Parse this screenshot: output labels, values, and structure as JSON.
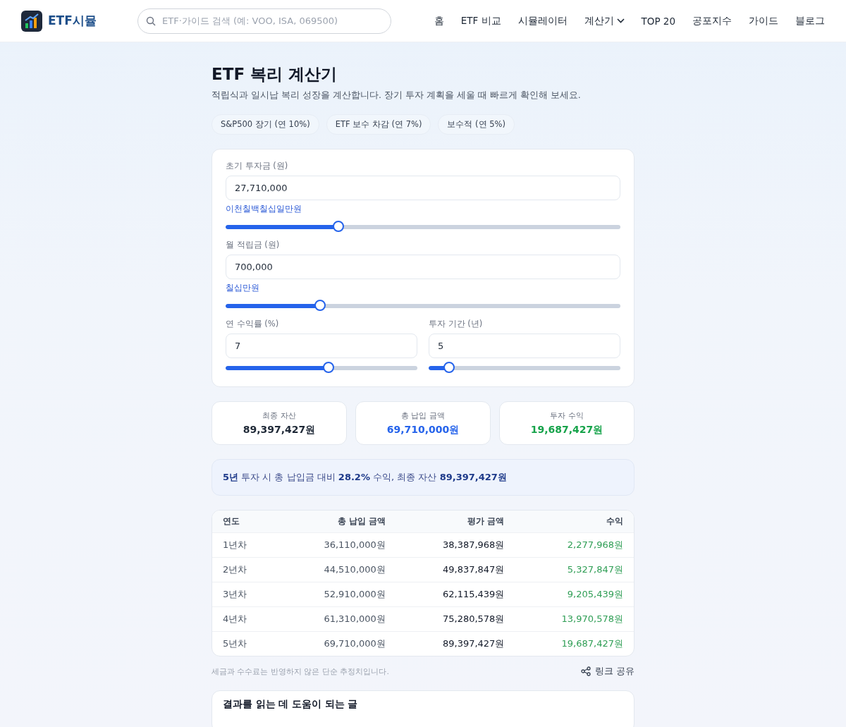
{
  "header": {
    "logo": "ETF시뮬",
    "search": {
      "placeholder": "ETF·가이드 검색 (예: VOO, ISA, 069500)"
    },
    "nav": [
      {
        "label": "홈",
        "dropdown": false
      },
      {
        "label": "ETF 비교",
        "dropdown": false
      },
      {
        "label": "시뮬레이터",
        "dropdown": false
      },
      {
        "label": "계산기",
        "dropdown": true
      },
      {
        "label": "TOP 20",
        "dropdown": false
      },
      {
        "label": "공포지수",
        "dropdown": false
      },
      {
        "label": "가이드",
        "dropdown": false
      },
      {
        "label": "블로그",
        "dropdown": false
      }
    ]
  },
  "title": "ETF 복리 계산기",
  "subtitle": "적립식과 일시납 복리 성장을 계산합니다. 장기 투자 계획을 세울 때 빠르게 확인해 보세요.",
  "presets": [
    "S&P500 장기 (연 10%)",
    "ETF 보수 차감 (연 7%)",
    "보수적 (연 5%)"
  ],
  "inputs": [
    {
      "label": "초기 투자금 (원)",
      "value": "27,710,000",
      "hint": "이천칠백칠십일만원",
      "level": 0.286
    },
    {
      "label": "월 적립금 (원)",
      "value": "700,000",
      "hint": "칠십만원",
      "level": 0.24
    },
    {
      "label": "연 수익률 (%)",
      "value": "7",
      "level": 0.537
    },
    {
      "label": "투자 기간 (년)",
      "value": "5",
      "level": 0.107
    }
  ],
  "stats": [
    {
      "label": "최종 자산",
      "value": "89,397,427원",
      "color": "#1f2937"
    },
    {
      "label": "총 납입 금액",
      "value": "69,710,000원",
      "color": "#2563eb"
    },
    {
      "label": "투자 수익",
      "value": "19,687,427원",
      "color": "#16a34a"
    }
  ],
  "summary": "**5년** 투자 시 총 납입금 대비 **28.2%** 수익, 최종 자산 **89,397,427원**",
  "table": {
    "columns": [
      "연도",
      "총 납입 금액",
      "평가 금액",
      "수익"
    ],
    "rows": [
      [
        "1년차",
        "36,110,000원",
        "38,387,968원",
        "2,277,968원"
      ],
      [
        "2년차",
        "44,510,000원",
        "49,837,847원",
        "5,327,847원"
      ],
      [
        "3년차",
        "52,910,000원",
        "62,115,439원",
        "9,205,439원"
      ],
      [
        "4년차",
        "61,310,000원",
        "75,280,578원",
        "13,970,578원"
      ],
      [
        "5년차",
        "69,710,000원",
        "89,397,427원",
        "19,687,427원"
      ]
    ]
  },
  "note": "세금과 수수료는 반영하지 않은 단순 추정치입니다.",
  "share": "링크 공유",
  "related_title": "결과를 읽는 데 도움이 되는 글"
}
